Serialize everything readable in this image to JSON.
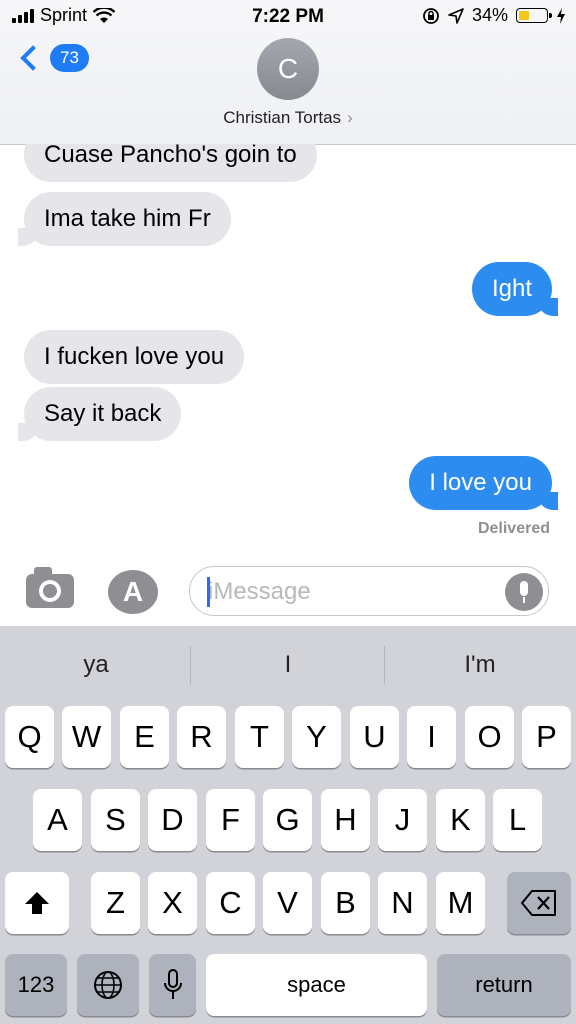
{
  "status_bar": {
    "carrier": "Sprint",
    "time": "7:22 PM",
    "battery_percent": "34%",
    "battery_level": 0.34,
    "icons": [
      "signal-icon",
      "wifi-icon",
      "rotation-lock-icon",
      "location-icon",
      "battery-icon",
      "charging-icon"
    ]
  },
  "header": {
    "back_count": "73",
    "avatar_initial": "C",
    "contact_name": "Christian Tortas",
    "contact_chevron": "›"
  },
  "messages": [
    {
      "text": "Cuase Pancho's goin to",
      "direction": "incoming"
    },
    {
      "text": "Ima take him Fr",
      "direction": "incoming"
    },
    {
      "text": "Ight",
      "direction": "outgoing"
    },
    {
      "text": "I fucken love you",
      "direction": "incoming"
    },
    {
      "text": "Say it back",
      "direction": "incoming"
    },
    {
      "text": "I love you",
      "direction": "outgoing"
    }
  ],
  "delivered_label": "Delivered",
  "composer": {
    "placeholder": "iMessage",
    "app_store_glyph": "A"
  },
  "suggestions": [
    "ya",
    "I",
    "I'm"
  ],
  "keyboard": {
    "row1": [
      "Q",
      "W",
      "E",
      "R",
      "T",
      "Y",
      "U",
      "I",
      "O",
      "P"
    ],
    "row2": [
      "A",
      "S",
      "D",
      "F",
      "G",
      "H",
      "J",
      "K",
      "L"
    ],
    "row3": [
      "Z",
      "X",
      "C",
      "V",
      "B",
      "N",
      "M"
    ],
    "numbers_label": "123",
    "space_label": "space",
    "return_label": "return",
    "shift_glyph": "⬆",
    "delete_glyph": "⌫",
    "globe_glyph": "🌐",
    "mic_glyph": "🎙"
  },
  "colors": {
    "imessage_blue": "#2d8cf0",
    "incoming_gray": "#e5e5ea",
    "badge_blue": "#1f7cf5",
    "keyboard_bg": "#d1d3d9"
  }
}
